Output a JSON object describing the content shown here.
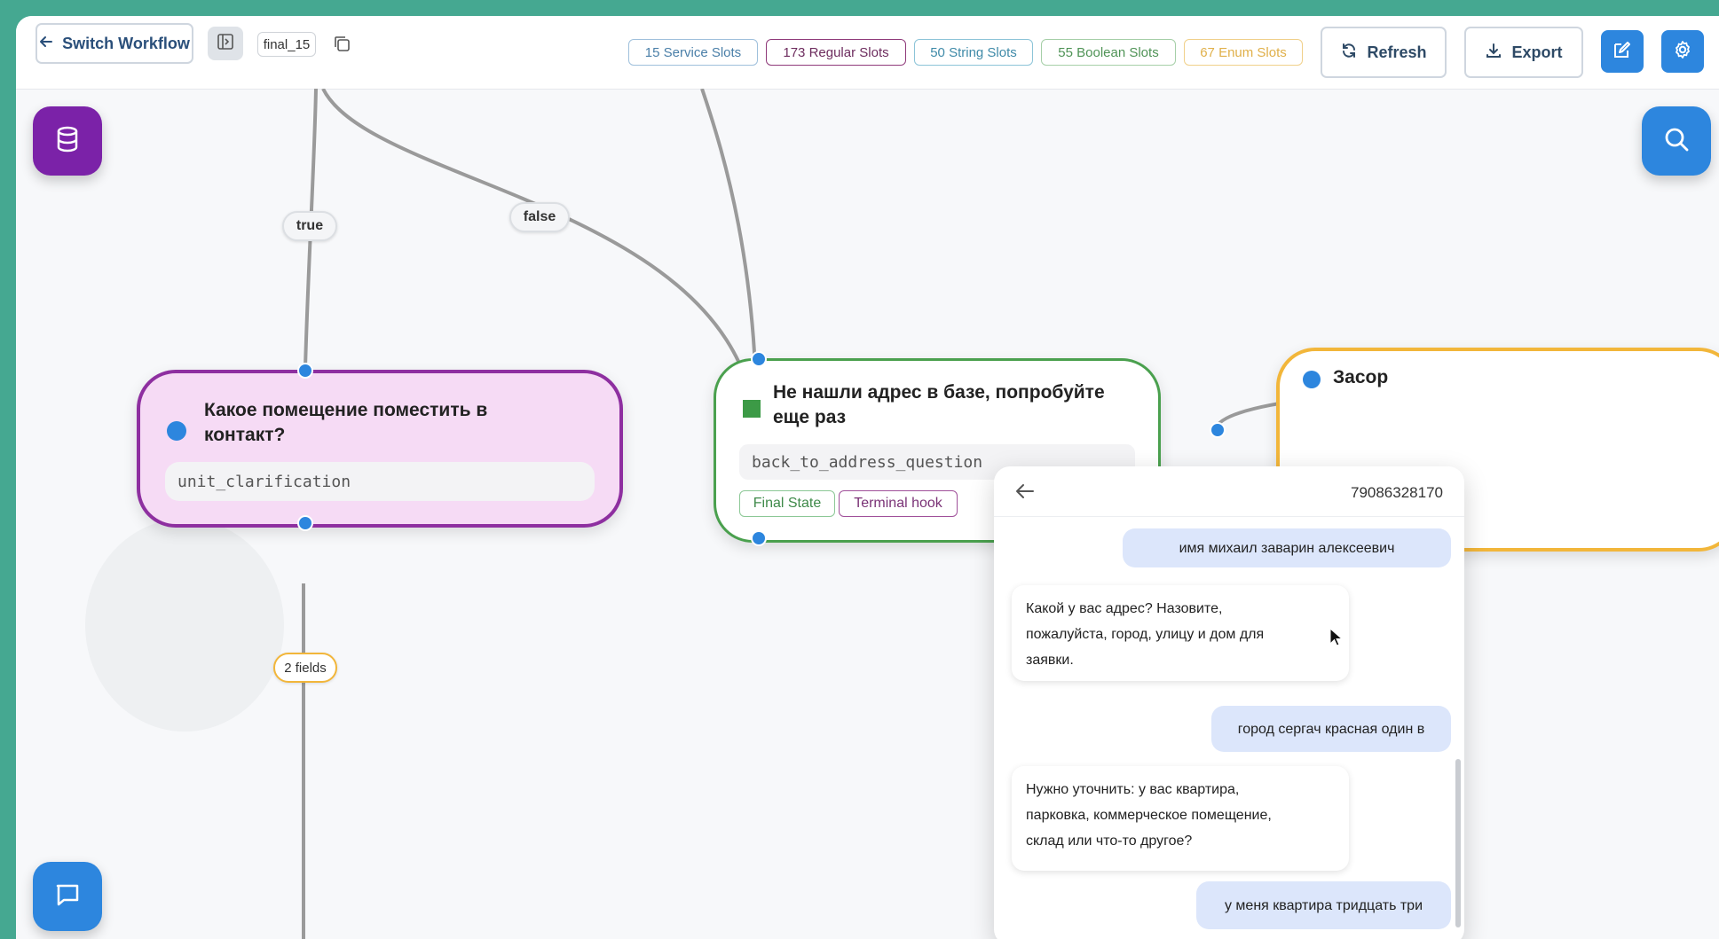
{
  "toolbar": {
    "switch_workflow_label": "Switch Workflow",
    "workflow_name": "final_15",
    "slots": {
      "service": "15 Service Slots",
      "regular": "173 Regular Slots",
      "string": "50 String Slots",
      "boolean": "55 Boolean Slots",
      "enum": "67 Enum Slots"
    },
    "refresh_label": "Refresh",
    "export_label": "Export"
  },
  "edges": {
    "true_label": "true",
    "false_label": "false",
    "fields_label": "2 fields"
  },
  "nodes": {
    "unit": {
      "title_line1": "Какое помещение поместить в",
      "title_line2": "контакт?",
      "code": "unit_clarification"
    },
    "not_found": {
      "title_line1": "Не нашли адрес в базе, попробуйте",
      "title_line2": "еще раз",
      "code": "back_to_address_question",
      "tag_final": "Final State",
      "tag_hook": "Terminal hook"
    },
    "zasor": {
      "title": "Засор"
    }
  },
  "chat": {
    "phone": "79086328170",
    "messages": [
      {
        "role": "user",
        "text": "имя михаил заварин алексеевич"
      },
      {
        "role": "bot",
        "lines": [
          "Какой у вас адрес? Назовите,",
          "пожалуйста, город, улицу и дом для",
          "заявки."
        ]
      },
      {
        "role": "user",
        "text": "город сергач красная один в"
      },
      {
        "role": "bot",
        "lines": [
          "Нужно уточнить: у вас квартира,",
          "парковка, коммерческое помещение,",
          "склад или что-то другое?"
        ]
      },
      {
        "role": "user",
        "text": "у меня квартира тридцать три"
      }
    ]
  },
  "colors": {
    "accent_blue": "#2d86de",
    "node_purple": "#8e2fa0",
    "node_green": "#4aa04e",
    "node_orange": "#f2b63a",
    "db_button": "#7b22a8"
  }
}
